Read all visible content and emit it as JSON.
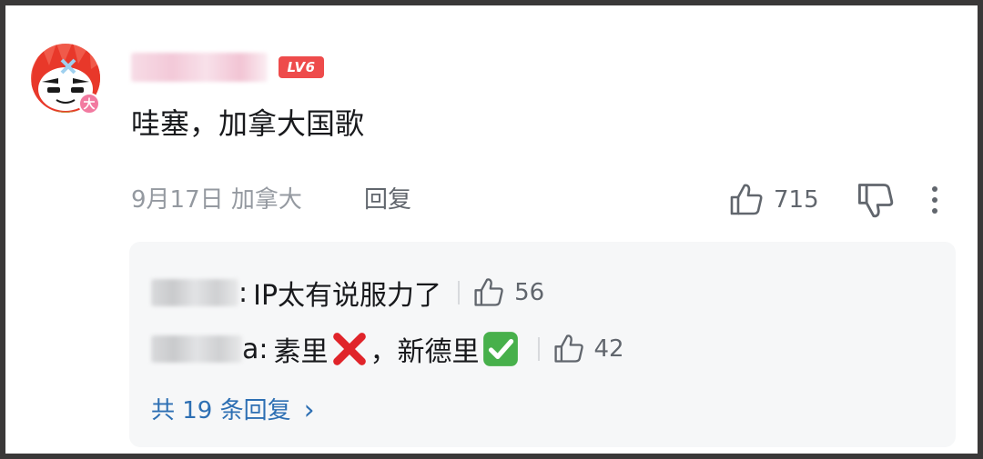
{
  "comment": {
    "username": "",
    "level_badge": "LV6",
    "avatar_badge": "大",
    "text": "哇塞，加拿大国歌",
    "date": "9月17日 加拿大",
    "reply_label": "回复",
    "like_count": "715",
    "icons": {
      "like": "thumbs-up-icon",
      "dislike": "thumbs-down-icon",
      "more": "more-vertical-icon"
    }
  },
  "replies": {
    "items": [
      {
        "name_suffix": ":",
        "text": "IP太有说服力了",
        "like_count": "56"
      },
      {
        "name_suffix": "a:",
        "text_before": "素里",
        "text_middle": "，新德里",
        "like_count": "42"
      }
    ],
    "total_label": "共 19 条回复",
    "total_chevron": "›"
  },
  "colors": {
    "link_blue": "#2d6fb3",
    "level_red": "#ee4b4b",
    "secondary_text": "#9499a0"
  }
}
